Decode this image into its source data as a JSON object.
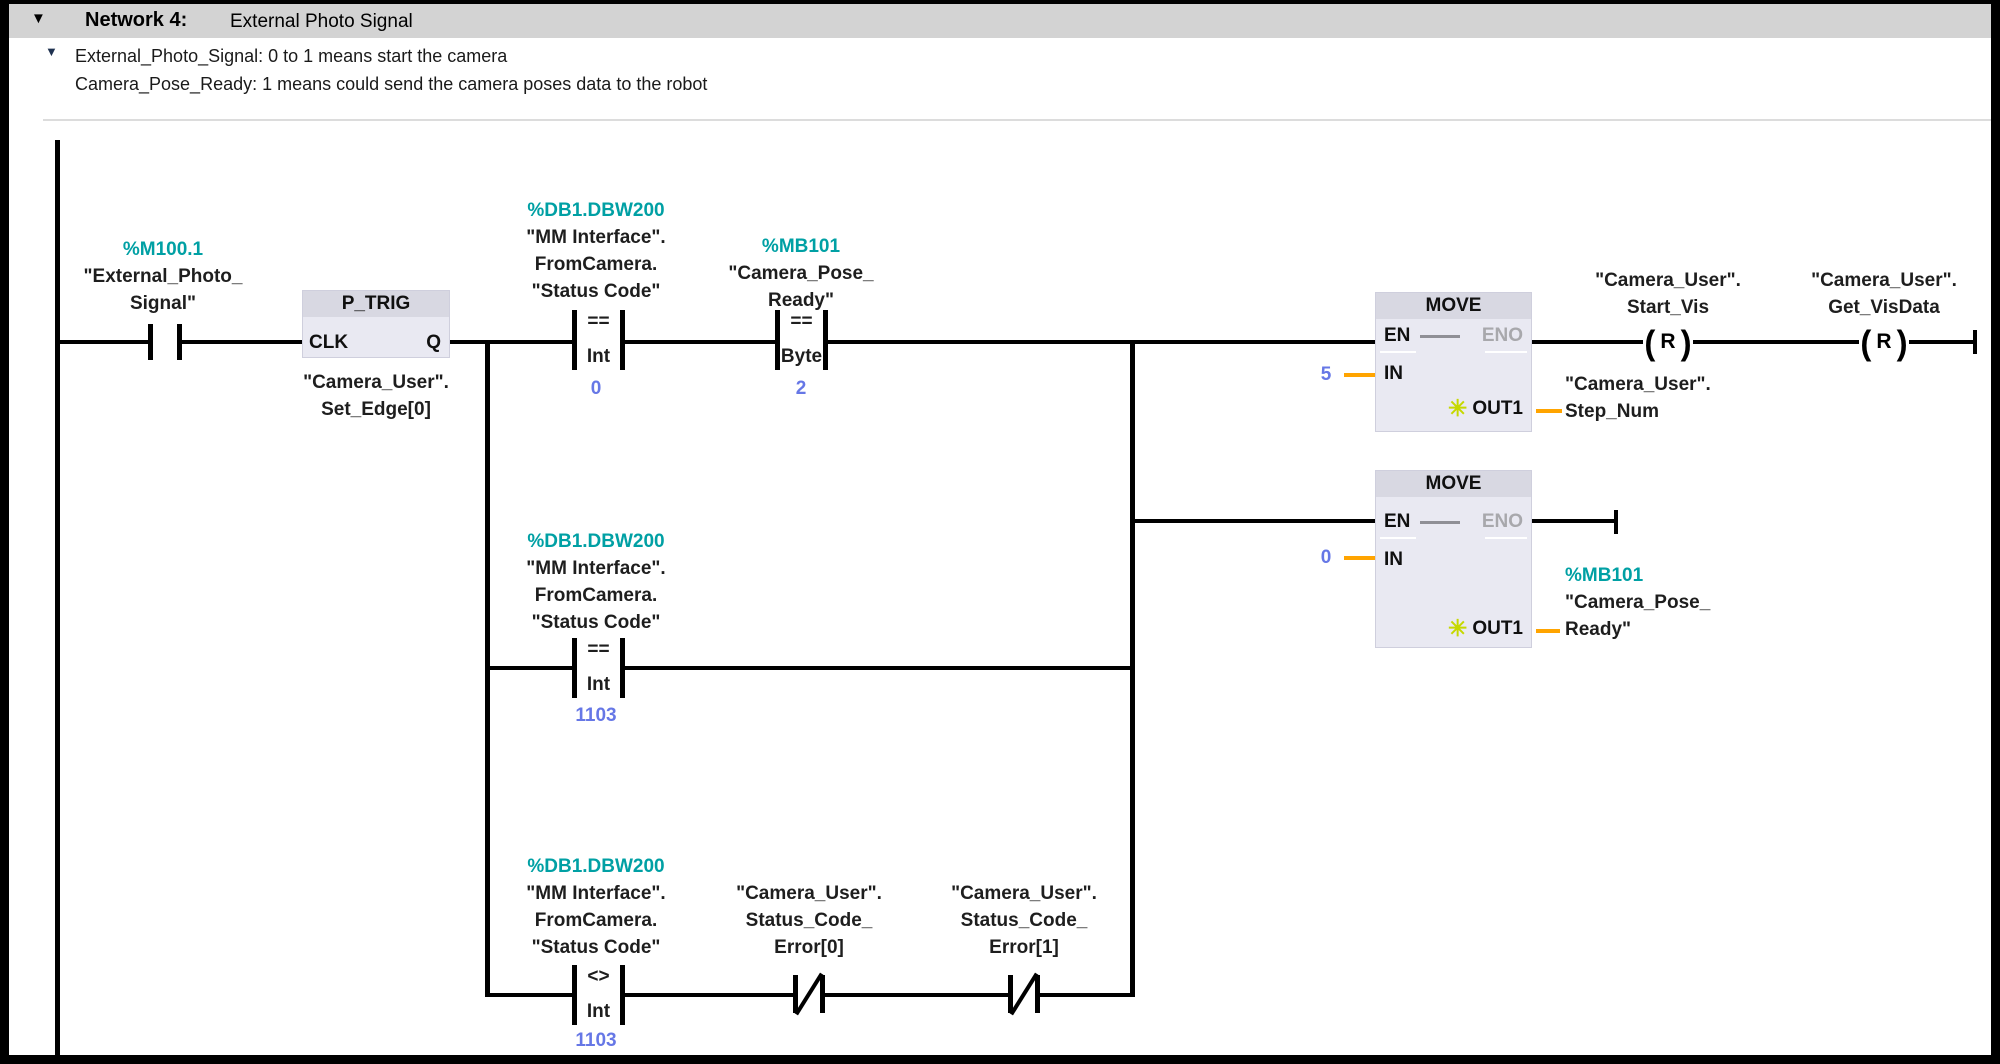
{
  "titlebar": {
    "collapse_icon": "triangle-down",
    "network_label": "Network 4:",
    "network_title": "External Photo Signal"
  },
  "comment": {
    "collapse_icon": "triangle-down",
    "line1": "External_Photo_Signal: 0 to 1 means start the camera",
    "line2": "Camera_Pose_Ready: 1 means could send the camera poses data to the robot"
  },
  "colors": {
    "address_teal": "#00A0A4",
    "constant_blue": "#6677E6",
    "wire_orange": "#FFA400",
    "eno_gray": "#A8A8AC",
    "box_body": "#E9E9F2",
    "box_header": "#D8D8E2",
    "titlebar_gray": "#D3D3D3",
    "star_green": "#C6D800"
  },
  "contact_photo": {
    "address": "%M100.1",
    "tag1": "\"External_Photo_",
    "tag2": "Signal\""
  },
  "ptrig": {
    "title": "P_TRIG",
    "clk": "CLK",
    "q": "Q",
    "tag1": "\"Camera_User\".",
    "tag2": "Set_Edge[0]"
  },
  "cmp_status_eq0": {
    "address": "%DB1.DBW200",
    "tag1": "\"MM Interface\".",
    "tag2": "FromCamera.",
    "tag3": "\"Status Code\"",
    "op": "==",
    "type": "Int",
    "value": "0"
  },
  "cmp_pose_eq2": {
    "address": "%MB101",
    "tag1": "\"Camera_Pose_",
    "tag2": "Ready\"",
    "op": "==",
    "type": "Byte",
    "value": "2"
  },
  "move1": {
    "title": "MOVE",
    "en": "EN",
    "eno": "ENO",
    "in": "IN",
    "out": "OUT1",
    "in_value": "5",
    "out_tag1": "\"Camera_User\".",
    "out_tag2": "Step_Num"
  },
  "coil_start_vis": {
    "symbol": "R",
    "tag1": "\"Camera_User\".",
    "tag2": "Start_Vis"
  },
  "coil_get_visdata": {
    "symbol": "R",
    "tag1": "\"Camera_User\".",
    "tag2": "Get_VisData"
  },
  "move2": {
    "title": "MOVE",
    "en": "EN",
    "eno": "ENO",
    "in": "IN",
    "out": "OUT1",
    "in_value": "0",
    "out_address": "%MB101",
    "out_tag1": "\"Camera_Pose_",
    "out_tag2": "Ready\""
  },
  "cmp_status_eq1103": {
    "address": "%DB1.DBW200",
    "tag1": "\"MM Interface\".",
    "tag2": "FromCamera.",
    "tag3": "\"Status Code\"",
    "op": "==",
    "type": "Int",
    "value": "1103"
  },
  "cmp_status_ne1103": {
    "address": "%DB1.DBW200",
    "tag1": "\"MM Interface\".",
    "tag2": "FromCamera.",
    "tag3": "\"Status Code\"",
    "op": "<>",
    "type": "Int",
    "value": "1103"
  },
  "nc_error0": {
    "tag1": "\"Camera_User\".",
    "tag2": "Status_Code_",
    "tag3": "Error[0]"
  },
  "nc_error1": {
    "tag1": "\"Camera_User\".",
    "tag2": "Status_Code_",
    "tag3": "Error[1]"
  }
}
